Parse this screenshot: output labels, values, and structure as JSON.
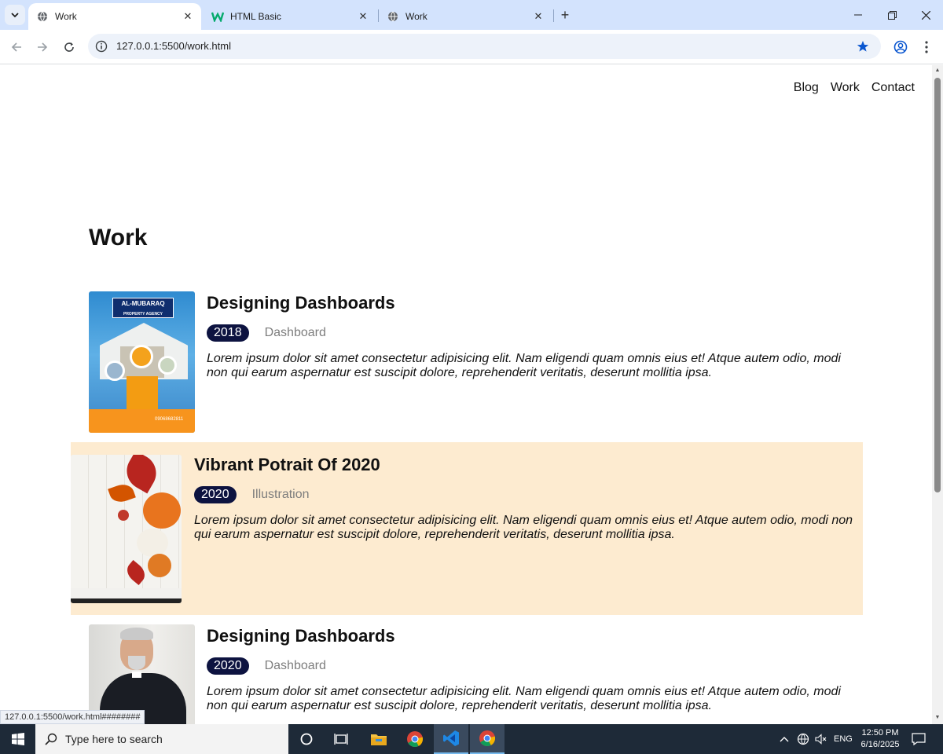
{
  "browser": {
    "tabs": [
      {
        "title": "Work",
        "active": true
      },
      {
        "title": "HTML Basic",
        "active": false
      },
      {
        "title": "Work",
        "active": false
      }
    ],
    "url": "127.0.0.1:5500/work.html",
    "status_url": "127.0.0.1:5500/work.html########"
  },
  "site": {
    "nav": [
      "Blog",
      "Work",
      "Contact"
    ],
    "page_title": "Work",
    "works": [
      {
        "title": "Designing Dashboards",
        "year": "2018",
        "category": "Dashboard",
        "description": "Lorem ipsum dolor sit amet consectetur adipisicing elit. Nam eligendi quam omnis eius et! Atque autem odio, modi non qui earum aspernatur est suscipit dolore, reprehenderit veritatis, deserunt mollitia ipsa.",
        "thumb_text_top": "AL-MUBARAQ",
        "thumb_text_sub": "PROPERTY AGENCY",
        "thumb_phone": "09068682811"
      },
      {
        "title": "Vibrant Potrait Of 2020",
        "year": "2020",
        "category": "Illustration",
        "description": "Lorem ipsum dolor sit amet consectetur adipisicing elit. Nam eligendi quam omnis eius et! Atque autem odio, modi non qui earum aspernatur est suscipit dolore, reprehenderit veritatis, deserunt mollitia ipsa.",
        "highlight_color": "#fdebd0"
      },
      {
        "title": "Designing Dashboards",
        "year": "2020",
        "category": "Dashboard",
        "description": "Lorem ipsum dolor sit amet consectetur adipisicing elit. Nam eligendi quam omnis eius et! Atque autem odio, modi non qui earum aspernatur est suscipit dolore, reprehenderit veritatis, deserunt mollitia ipsa."
      }
    ]
  },
  "taskbar": {
    "search_placeholder": "Type here to search",
    "language": "ENG",
    "time": "12:50 PM",
    "date": "6/16/2025"
  },
  "colors": {
    "tabbar": "#d3e3fd",
    "year_badge": "#0d1340",
    "highlight": "#fdebd0"
  }
}
